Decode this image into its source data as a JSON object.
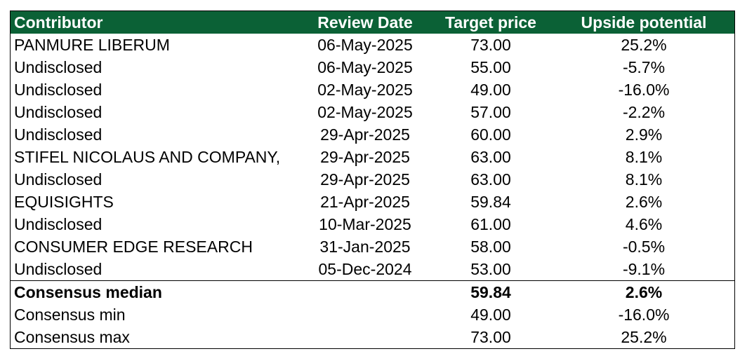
{
  "table": {
    "headers": {
      "contributor": "Contributor",
      "review_date": "Review Date",
      "target_price": "Target price",
      "upside": "Upside potential"
    },
    "rows": [
      {
        "contributor": "PANMURE LIBERUM",
        "date": "06-May-2025",
        "price": "73.00",
        "upside": "25.2%"
      },
      {
        "contributor": "Undisclosed",
        "date": "06-May-2025",
        "price": "55.00",
        "upside": "-5.7%"
      },
      {
        "contributor": "Undisclosed",
        "date": "02-May-2025",
        "price": "49.00",
        "upside": "-16.0%"
      },
      {
        "contributor": "Undisclosed",
        "date": "02-May-2025",
        "price": "57.00",
        "upside": "-2.2%"
      },
      {
        "contributor": "Undisclosed",
        "date": "29-Apr-2025",
        "price": "60.00",
        "upside": "2.9%"
      },
      {
        "contributor": "STIFEL NICOLAUS AND COMPANY,",
        "date": "29-Apr-2025",
        "price": "63.00",
        "upside": "8.1%"
      },
      {
        "contributor": "Undisclosed",
        "date": "29-Apr-2025",
        "price": "63.00",
        "upside": "8.1%"
      },
      {
        "contributor": "EQUISIGHTS",
        "date": "21-Apr-2025",
        "price": "59.84",
        "upside": "2.6%"
      },
      {
        "contributor": "Undisclosed",
        "date": "10-Mar-2025",
        "price": "61.00",
        "upside": "4.6%"
      },
      {
        "contributor": "CONSUMER EDGE RESEARCH",
        "date": "31-Jan-2025",
        "price": "58.00",
        "upside": "-0.5%"
      },
      {
        "contributor": "Undisclosed",
        "date": "05-Dec-2024",
        "price": "53.00",
        "upside": "-9.1%"
      }
    ],
    "summary": [
      {
        "label": "Consensus median",
        "price": "59.84",
        "upside": "2.6%"
      },
      {
        "label": "Consensus min",
        "price": "49.00",
        "upside": "-16.0%"
      },
      {
        "label": "Consensus max",
        "price": "73.00",
        "upside": "25.2%"
      }
    ]
  },
  "colors": {
    "header_background": "#0b6136",
    "header_text": "#ffffff",
    "border": "#000000"
  }
}
